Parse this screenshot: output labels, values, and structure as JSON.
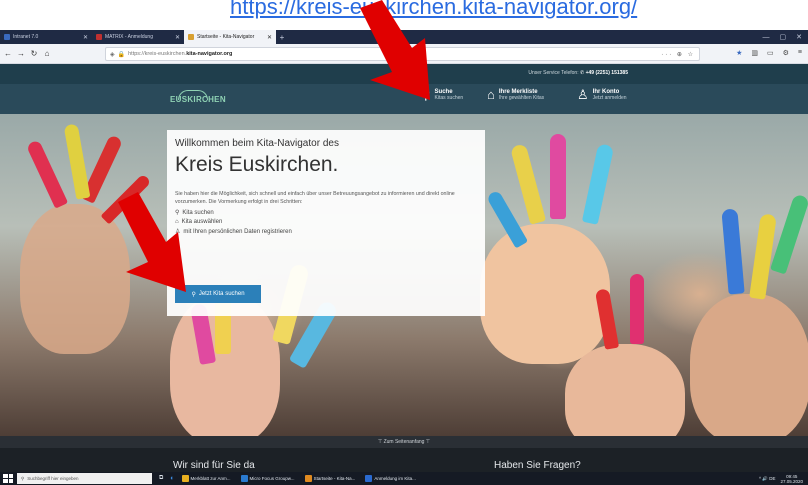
{
  "top_link": "https://kreis-euskirchen.kita-navigator.org/",
  "browser": {
    "tabs": [
      {
        "label": "Intranet 7.0",
        "favicon_color": "#3a6ac0"
      },
      {
        "label": "MATRIX - Anmeldung",
        "favicon_color": "#c03030"
      },
      {
        "label": "Startseite - Kita-Navigator",
        "favicon_color": "#d8a030"
      }
    ],
    "new_tab": "+",
    "url_prefix": "https://kreis-euskirchen.",
    "url_domain": "kita-navigator.org",
    "url_meta": "··· ⊕ ☆"
  },
  "site": {
    "service_label": "Unser Service Telefon:",
    "service_phone": "+49 (2251) 151385",
    "logo": "EUSKIRCHEN",
    "nav": [
      {
        "title": "Suche",
        "sub": "Kitas suchen"
      },
      {
        "title": "Ihre Merkliste",
        "sub": "Ihre gewählten Kitas"
      },
      {
        "title": "Ihr Konto",
        "sub": "Jetzt anmelden"
      }
    ]
  },
  "hero": {
    "welcome": "Willkommen beim Kita-Navigator des",
    "title": "Kreis Euskirchen.",
    "description": "Sie haben hier die Möglichkeit, sich schnell und einfach über unser Betreuungsangebot zu informieren und direkt online vorzumerken. Die Vormerkung erfolgt in drei Schritten:",
    "steps": [
      "Kita suchen",
      "Kita auswählen",
      "mit Ihren persönlichen Daten registrieren"
    ],
    "button": "Jetzt Kita suchen"
  },
  "footer": {
    "to_top": "Zum Seitenanfang",
    "col1": "Wir sind für Sie da",
    "col2": "Haben Sie Fragen?"
  },
  "taskbar": {
    "search_placeholder": "Suchbegriff hier eingeben",
    "items": [
      {
        "label": "Merkblatt zur Anm...",
        "color": "#e8b020"
      },
      {
        "label": "Micro Focus Groupw...",
        "color": "#2a7ad0"
      },
      {
        "label": "Startseite - Kita-Na...",
        "color": "#e08a20"
      },
      {
        "label": "Anmeldung im Kita...",
        "color": "#2a6ad0"
      }
    ],
    "tray": "^ 🔊 DE",
    "time": "09:45",
    "date": "27.05.2020"
  }
}
